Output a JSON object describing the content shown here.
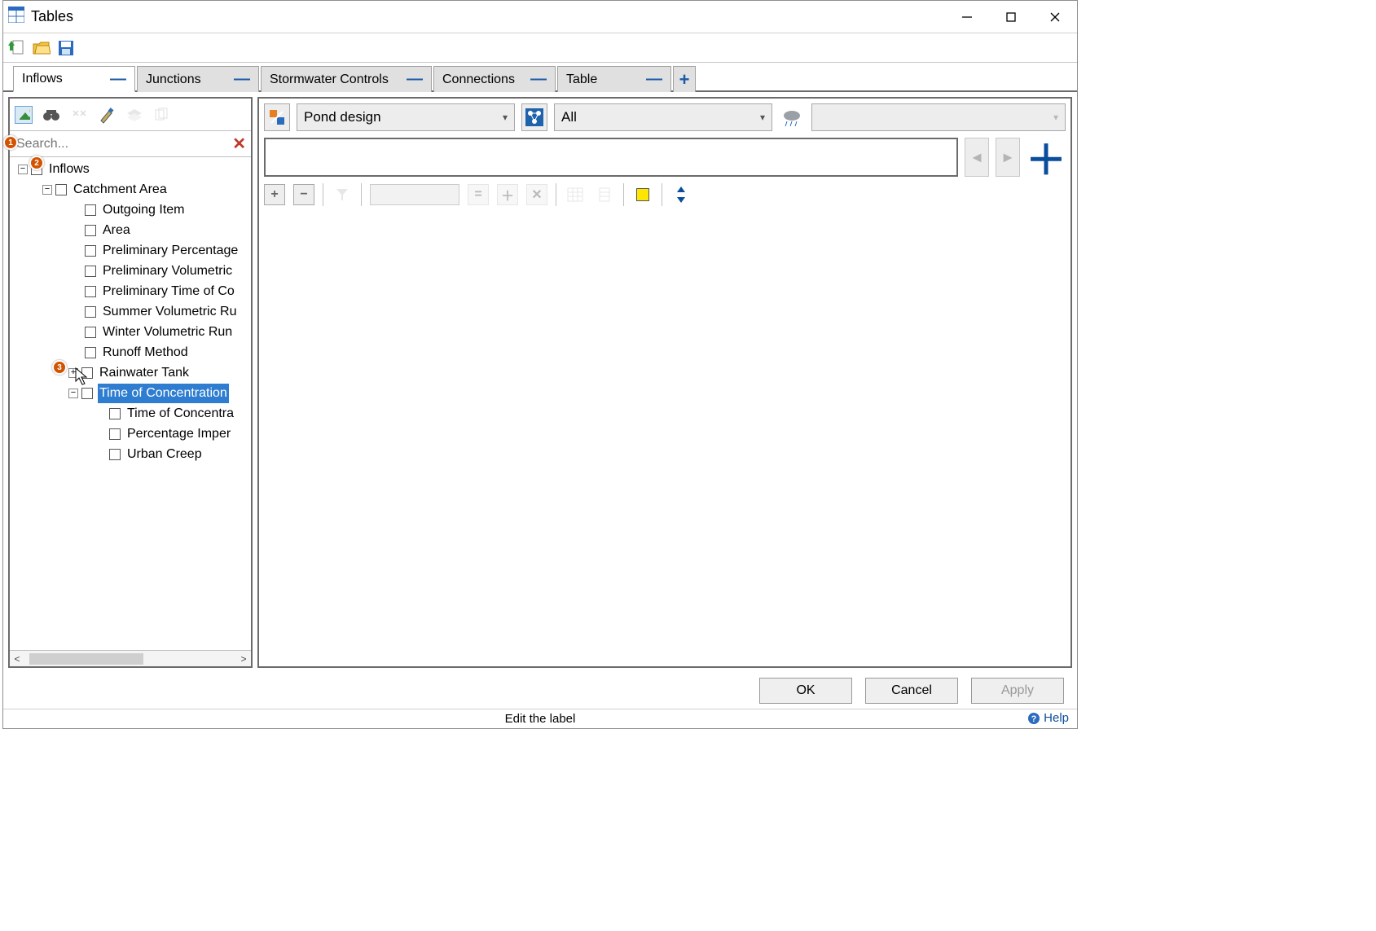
{
  "window": {
    "title": "Tables"
  },
  "tabs": [
    {
      "label": "Inflows",
      "active": true
    },
    {
      "label": "Junctions",
      "active": false
    },
    {
      "label": "Stormwater Controls",
      "active": false
    },
    {
      "label": "Connections",
      "active": false
    },
    {
      "label": "Table",
      "active": false
    }
  ],
  "left_toolbar": {
    "buttons": [
      "map-layers",
      "binoculars",
      "arrows",
      "brush",
      "layers-2",
      "copy"
    ]
  },
  "search": {
    "placeholder": "Search..."
  },
  "tree": {
    "root": {
      "label": "Inflows",
      "expanded": true,
      "children": [
        {
          "label": "Catchment Area",
          "expanded": true,
          "children": [
            {
              "label": "Outgoing Item"
            },
            {
              "label": "Area"
            },
            {
              "label": "Preliminary Percentage"
            },
            {
              "label": "Preliminary Volumetric"
            },
            {
              "label": "Preliminary Time of Co"
            },
            {
              "label": "Summer Volumetric Ru"
            },
            {
              "label": "Winter Volumetric Run"
            },
            {
              "label": "Runoff Method"
            },
            {
              "label": "Rainwater Tank",
              "expandable": true
            },
            {
              "label": "Time of Concentration",
              "expanded": true,
              "selected": true,
              "children": [
                {
                  "label": "Time of Concentra"
                },
                {
                  "label": "Percentage Imper"
                },
                {
                  "label": "Urban Creep"
                }
              ]
            }
          ]
        }
      ]
    }
  },
  "right": {
    "design_select": "Pond design",
    "filter_select": "All"
  },
  "buttons": {
    "ok": "OK",
    "cancel": "Cancel",
    "apply": "Apply"
  },
  "status": {
    "text": "Edit the label",
    "help": "Help"
  },
  "annotations": [
    {
      "n": "1"
    },
    {
      "n": "2"
    },
    {
      "n": "3"
    }
  ]
}
